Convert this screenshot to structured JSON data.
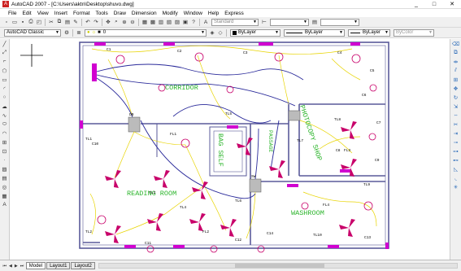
{
  "window": {
    "title": "AutoCAD 2007 - [C:\\Users\\aktn\\Desktop\\shuvo.dwg]",
    "minimize": "_",
    "maximize": "□",
    "close": "✕"
  },
  "menu": [
    "File",
    "Edit",
    "View",
    "Insert",
    "Format",
    "Tools",
    "Draw",
    "Dimension",
    "Modify",
    "Window",
    "Help",
    "Express"
  ],
  "toolbar": {
    "workspace": "AutoCAD Classic",
    "text_style": "Standard",
    "layer": "0",
    "color": "ByLayer",
    "linetype": "ByLayer",
    "lineweight": "ByLayer",
    "plotstyle": "ByColor"
  },
  "rooms": {
    "corridor": "CORRIDOR",
    "reading_room": "READING ROOM",
    "washroom": "WASHROOM",
    "photocopy_shop": "PHOTOCOPY SHOP",
    "bag_self": "BAG SELF",
    "passage": "PASSAGE"
  },
  "tags": {
    "c1": "C1",
    "c2": "C2",
    "c3": "C3",
    "c4": "C4",
    "c5": "C5",
    "c6": "C6",
    "c7": "C7",
    "c8": "C8",
    "c9": "C9",
    "c10": "C10",
    "c11": "C11",
    "c12": "C12",
    "c13": "C13",
    "c14": "C14",
    "tl1": "TL1",
    "tl2": "TL2",
    "tl3": "TL3",
    "tl4": "TL4",
    "tl5": "TL5",
    "tl6": "TL6",
    "tl7": "TL7",
    "tl8": "TL8",
    "tl9": "TL9",
    "tl10": "TL10",
    "fl1": "FL1",
    "fl2": "FL2",
    "fl3": "FL3",
    "fl4": "FL4",
    "sw": "SW",
    "db": "DB"
  },
  "tabs": {
    "model": "Model",
    "layout1": "Layout1",
    "layout2": "Layout2",
    "nav": [
      "⏮",
      "◀",
      "▶",
      "⏭"
    ]
  },
  "colors": {
    "wall": "#5a5a9a",
    "wire_yellow": "#e8d400",
    "wire_blue": "#2a2a9a",
    "magenta": "#d000d0",
    "label_green": "#2db52d",
    "fan_red": "#c8006a"
  },
  "icons": {
    "left_toolbar": [
      "line-icon",
      "construction-line-icon",
      "polyline-icon",
      "polygon-icon",
      "rectangle-icon",
      "arc-icon",
      "circle-icon",
      "revision-cloud-icon",
      "spline-icon",
      "ellipse-icon",
      "ellipse-arc-icon",
      "insert-block-icon",
      "make-block-icon",
      "point-icon",
      "hatch-icon",
      "gradient-icon",
      "region-icon",
      "table-icon",
      "multiline-text-icon"
    ],
    "right_toolbar": [
      "erase-icon",
      "copy-icon",
      "mirror-icon",
      "offset-icon",
      "array-icon",
      "move-icon",
      "rotate-icon",
      "scale-icon",
      "stretch-icon",
      "trim-icon",
      "extend-icon",
      "break-at-point-icon",
      "break-icon",
      "join-icon",
      "chamfer-icon",
      "fillet-icon",
      "explode-icon"
    ]
  }
}
